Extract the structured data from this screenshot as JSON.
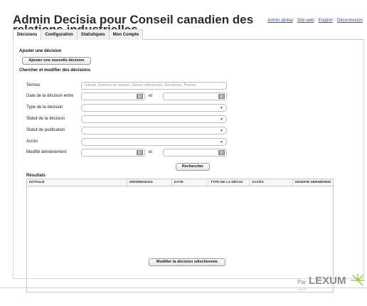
{
  "header": {
    "title": "Admin Decisia pour Conseil canadien des relations industrielles",
    "links": [
      "Admin global",
      "Site web",
      "English",
      "Déconnexion"
    ]
  },
  "tabs": [
    "Décisions",
    "Configuration",
    "Statistiques",
    "Mon Compte"
  ],
  "add_section": {
    "label": "Ajouter une décision",
    "button": "Ajouter une nouvelle décision"
  },
  "search_section": {
    "label": "Chercher et modifier des décisions",
    "fields": {
      "terms_label": "Termes",
      "terms_placeholder": "Intitulé, Numéro de dossier, Autres références, Décideurs, Parties",
      "date_label": "Date de la décision entre",
      "and_label": "et",
      "type_label": "Type de la décision",
      "status_label": "Statut de la décision",
      "pub_status_label": "Statut de publication",
      "access_label": "Accès",
      "modified_label": "Modifié dernièrement"
    },
    "search_button": "Rechercher"
  },
  "results": {
    "label": "Résultats",
    "columns": [
      "INTITULÉ",
      "RÉFÉRENCES",
      "DATE",
      "TYPE DE LA DÉCISI",
      "ACCÈS",
      "MODIFIÉ DERNIÈREM"
    ]
  },
  "modify_button": "Modifier la décision sélectionnée",
  "footer": {
    "par": "Par",
    "brand": "LEXUM",
    "version": "v3.4.8"
  },
  "colors": {
    "link": "#3a4db0",
    "brand_gray": "#8c8c8c",
    "logo_green": "#8dc63f"
  }
}
